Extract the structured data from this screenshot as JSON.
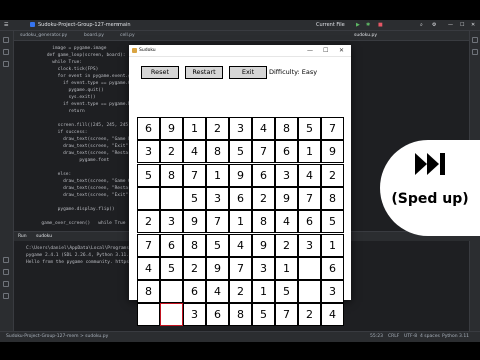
{
  "ide": {
    "project_title": "Sudoku-Project-Group-127-mem",
    "version_control": "main",
    "run_config": "Current File",
    "tabs": [
      "sudoku_generator.py",
      "board.py",
      "cell.py",
      "sudoku.py"
    ],
    "code_lines": [
      "      image = pygame.image",
      "    def game_loop(screen, board):",
      "      while True:",
      "        clock.tick(FPS)",
      "        for event in pygame.event.get():",
      "          if event.type == pygame.QUIT:",
      "            pygame.quit()",
      "            sys.exit()",
      "          if event.type == pygame.MOUSE",
      "            return",
      "",
      "        screen.fill((245, 245, 245))",
      "        if success:",
      "          draw_text(screen, \"Game Won!\"",
      "          draw_text(screen, \"Exit\"",
      "          draw_text(screen, \"Restart\"",
      "                pygame.font",
      "",
      "        else:",
      "          draw_text(screen, \"Game Over\"",
      "          draw_text(screen, \"Restart\"",
      "          draw_text(screen, \"Exit\"",
      "",
      "        pygame.display.flip()",
      "",
      "  game_over_screen()   while True   for event in"
    ],
    "run_tab": "Run",
    "run_file": "sudoku",
    "console_lines": [
      "C:\\Users\\daniel\\AppData\\Local\\Programs\\Python\\Python311\\python.exe  C:\\Users\\...\\Sudoku-Project-Group-127\\sudoku.py",
      "pygame 2.4.1 (SDL 2.26.4, Python 3.11.4)",
      "Hello from the pygame community. https://www.pygame.org/contribute.html"
    ],
    "status_left": "Sudoku-Project-Group-127-mem  >  sudoku.py",
    "status_right": [
      "55:23",
      "CRLF",
      "UTF-8",
      "4 spaces",
      "Python 3.11"
    ]
  },
  "sudoku_window": {
    "title": "Sudoku",
    "buttons": {
      "reset": "Reset",
      "restart": "Restart",
      "exit": "Exit"
    },
    "difficulty": "Difficulty: Easy",
    "board": [
      [
        "6",
        "9",
        "1",
        "2",
        "3",
        "4",
        "8",
        "5",
        "7"
      ],
      [
        "3",
        "2",
        "4",
        "8",
        "5",
        "7",
        "6",
        "1",
        "9"
      ],
      [
        "5",
        "8",
        "7",
        "1",
        "9",
        "6",
        "3",
        "4",
        "2"
      ],
      [
        "",
        "",
        "5",
        "3",
        "6",
        "2",
        "9",
        "7",
        "8"
      ],
      [
        "2",
        "3",
        "9",
        "7",
        "1",
        "8",
        "4",
        "6",
        "5"
      ],
      [
        "7",
        "6",
        "8",
        "5",
        "4",
        "9",
        "2",
        "3",
        "1"
      ],
      [
        "4",
        "5",
        "2",
        "9",
        "7",
        "3",
        "1",
        "",
        "6"
      ],
      [
        "8",
        "",
        "6",
        "4",
        "2",
        "1",
        "5",
        "",
        "3"
      ],
      [
        "",
        "",
        "3",
        "6",
        "8",
        "5",
        "7",
        "2",
        "4"
      ]
    ],
    "selected_cell": {
      "row": 8,
      "col": 1
    }
  },
  "overlay": {
    "label": "(Sped up)",
    "icon": "fast-forward-icon"
  },
  "colors": {
    "ide_bg": "#1e1f22",
    "selected_border": "#c1121f",
    "button_bg": "#d6d6d6"
  }
}
